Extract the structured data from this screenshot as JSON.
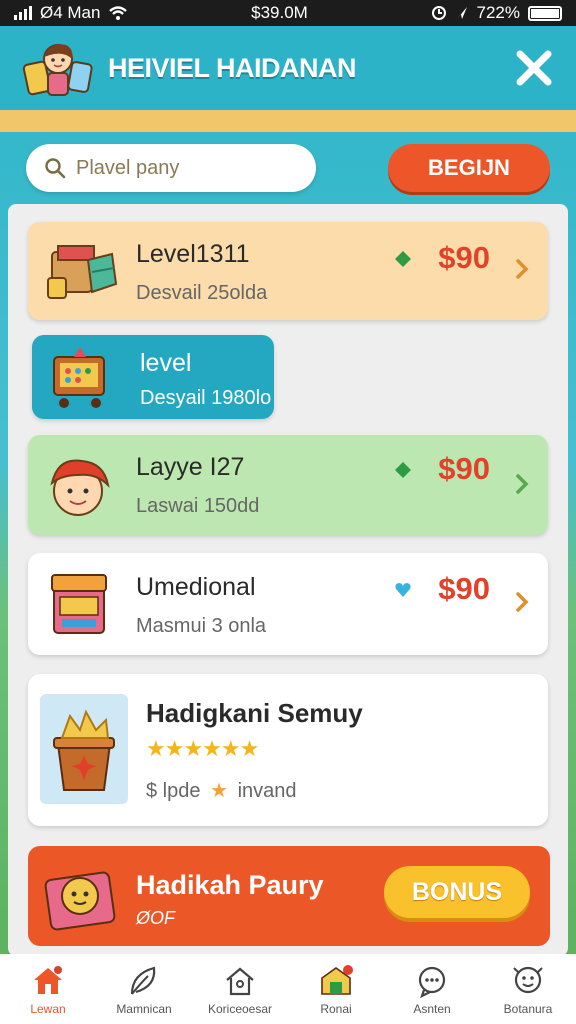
{
  "status_bar": {
    "carrier": "Ø4 Man",
    "center": "$39.0M",
    "right": "722%"
  },
  "header": {
    "title": "HEIVIEL HAIDANAN"
  },
  "search": {
    "placeholder": "Plavel pany"
  },
  "begin_button": "BEGIJN",
  "items": [
    {
      "name": "Level1311",
      "sub": "Desvail 25olda",
      "price": "$90",
      "gem_color": "#2e9a44",
      "bg": "#fbdcaa"
    },
    {
      "name": "level",
      "sub": "Desyail 1980lo",
      "bg": "#24a8c2"
    },
    {
      "name": "Layye I27",
      "sub": "Laswai 150dd",
      "price": "$90",
      "gem_color": "#2e9a44",
      "bg": "#bde7b1"
    },
    {
      "name": "Umedional",
      "sub": "Masmui 3 onla",
      "price": "$90",
      "gem_color": "#38b3dd",
      "bg": "#ffffff"
    }
  ],
  "featured": {
    "name": "Hadigkani Semuy",
    "stars": "★★★★★★",
    "sub_left": "$ lpde",
    "sub_right": "invand"
  },
  "bonus_card": {
    "title": "Hadikah Paury",
    "sub": "ØOF",
    "button": "BONUS"
  },
  "tabs": [
    {
      "label": "Lewan",
      "icon": "home-icon",
      "active": true
    },
    {
      "label": "Mamnican",
      "icon": "leaf-icon"
    },
    {
      "label": "Koriceoesar",
      "icon": "house-outline-icon"
    },
    {
      "label": "Ronai",
      "icon": "shop-icon",
      "badge": true
    },
    {
      "label": "Asnten",
      "icon": "chat-icon"
    },
    {
      "label": "Botanura",
      "icon": "mascot-icon"
    }
  ],
  "colors": {
    "accent": "#ec5629",
    "header": "#2db3c7",
    "price": "#e0432a"
  }
}
